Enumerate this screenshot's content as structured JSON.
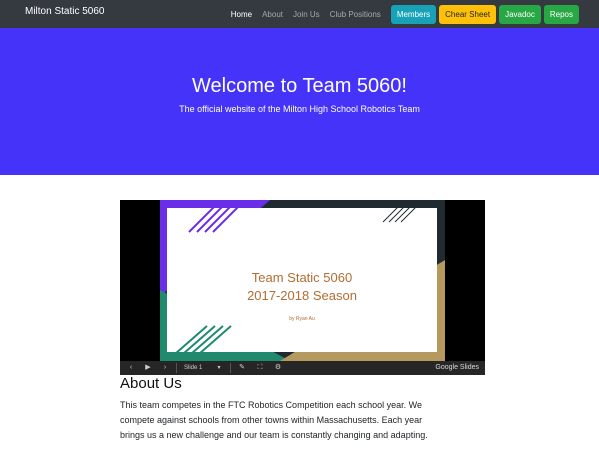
{
  "navbar": {
    "brand": "Milton Static 5060",
    "links": [
      {
        "label": "Home",
        "active": true
      },
      {
        "label": "About",
        "active": false
      },
      {
        "label": "Join Us",
        "active": false
      },
      {
        "label": "Club Positions",
        "active": false
      }
    ],
    "buttons": [
      {
        "label": "Members",
        "bg": "#17a2b8",
        "color": "#ffffff"
      },
      {
        "label": "Chear Sheet",
        "bg": "#ffc107",
        "color": "#212529"
      },
      {
        "label": "Javadoc",
        "bg": "#28a745",
        "color": "#ffffff"
      },
      {
        "label": "Repos",
        "bg": "#28a745",
        "color": "#ffffff"
      }
    ]
  },
  "hero": {
    "title": "Welcome to Team 5060!",
    "subtitle": "The official website of the Milton High School Robotics Team",
    "bg": "#4533fa"
  },
  "slides": {
    "title_line1": "Team Static 5060",
    "title_line2": "2017-2018 Season",
    "author": "by Ryan Au",
    "slide_indicator": "Slide 1",
    "provider": "Google Slides",
    "accent_purple": "#6a2ee8",
    "accent_teal": "#1f8a6e",
    "accent_gold": "#b69a5d",
    "text_color": "#b26d33",
    "icons": {
      "prev": "chevron-left-icon",
      "play": "play-icon",
      "next": "chevron-right-icon",
      "dropdown": "caret-down-icon",
      "edit": "pencil-icon",
      "fullscreen": "fullscreen-icon",
      "settings": "gear-icon"
    }
  },
  "about": {
    "heading": "About Us",
    "line1": "This team competes in the FTC Robotics Competition each school year. We",
    "line2": "compete against schools from other towns within Massachusetts. Each year",
    "line3": "brings us a new challenge and our team is constantly changing and adapting."
  }
}
